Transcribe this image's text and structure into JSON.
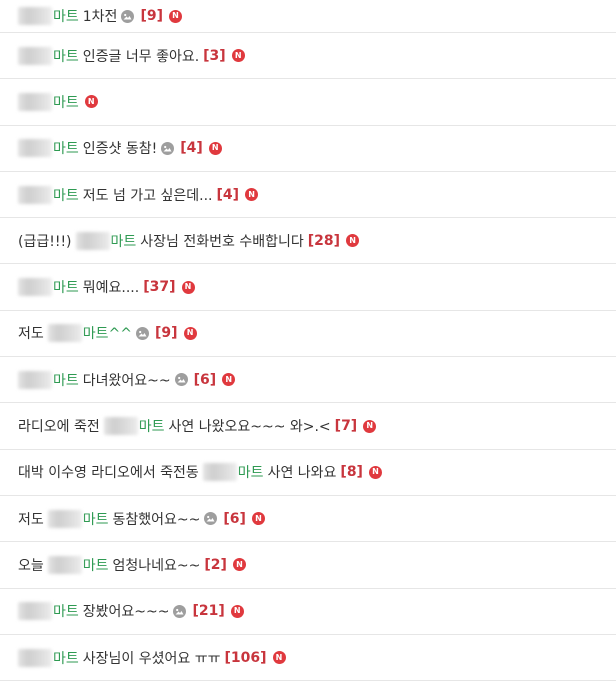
{
  "posts": [
    {
      "prefix": "",
      "blur_w": 34,
      "mart": "마트",
      "title": "1차전",
      "has_image": true,
      "count": "[9]",
      "new": "N"
    },
    {
      "prefix": "",
      "blur_w": 34,
      "mart": "마트",
      "title": "인증글 너무 좋아요.",
      "has_image": false,
      "count": "[3]",
      "new": "N"
    },
    {
      "prefix": "",
      "blur_w": 34,
      "mart": "마트",
      "title": "",
      "has_image": false,
      "count": "",
      "new": "N"
    },
    {
      "prefix": "",
      "blur_w": 34,
      "mart": "마트",
      "title": "인증샷 동참!",
      "has_image": true,
      "count": "[4]",
      "new": "N"
    },
    {
      "prefix": "",
      "blur_w": 34,
      "mart": "마트",
      "title": "저도 넘 가고 싶은데...",
      "has_image": false,
      "count": "[4]",
      "new": "N"
    },
    {
      "prefix": "(급급!!!)",
      "blur_w": 34,
      "mart": "마트",
      "title": "사장님 전화번호 수배합니다",
      "has_image": false,
      "count": "[28]",
      "new": "N"
    },
    {
      "prefix": "",
      "blur_w": 34,
      "mart": "마트",
      "title": "뭐예요....",
      "has_image": false,
      "count": "[37]",
      "new": "N"
    },
    {
      "prefix": "저도",
      "blur_w": 34,
      "mart": "마트^^",
      "title": "",
      "has_image": true,
      "count": "[9]",
      "new": "N"
    },
    {
      "prefix": "",
      "blur_w": 34,
      "mart": "마트",
      "title": "다녀왔어요~~",
      "has_image": true,
      "count": "[6]",
      "new": "N"
    },
    {
      "prefix": "라디오에 죽전",
      "blur_w": 34,
      "mart": "마트",
      "title": "사연 나왔오요~~~ 와>.<",
      "has_image": false,
      "count": "[7]",
      "new": "N"
    },
    {
      "prefix": "대박 이수영 라디오에서 죽전동",
      "blur_w": 34,
      "mart": "마트",
      "title": "사연 나와요",
      "has_image": false,
      "count": "[8]",
      "new": "N"
    },
    {
      "prefix": "저도",
      "blur_w": 34,
      "mart": "마트",
      "title": "동참했어요~~",
      "has_image": true,
      "count": "[6]",
      "new": "N"
    },
    {
      "prefix": "오늘",
      "blur_w": 34,
      "mart": "마트",
      "title": "엄청나네요~~",
      "has_image": false,
      "count": "[2]",
      "new": "N"
    },
    {
      "prefix": "",
      "blur_w": 34,
      "mart": "마트",
      "title": "장봤어요~~~",
      "has_image": true,
      "count": "[21]",
      "new": "N"
    },
    {
      "prefix": "",
      "blur_w": 34,
      "mart": "마트",
      "title": "사장님이 우셨어요 ㅠㅠ",
      "has_image": false,
      "count": "[106]",
      "new": "N"
    }
  ]
}
